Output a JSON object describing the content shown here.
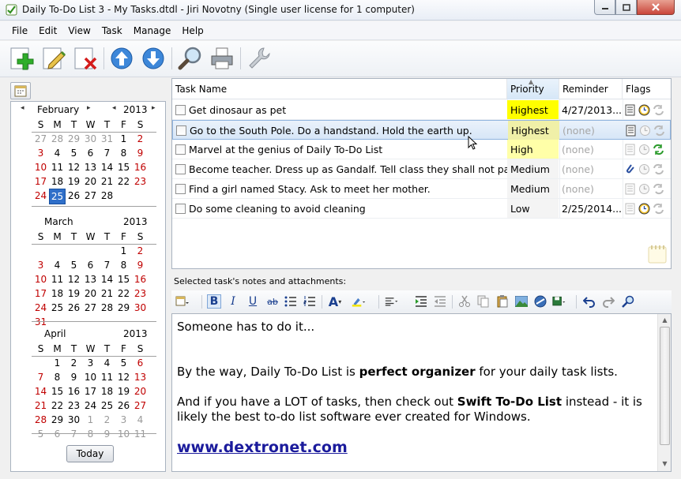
{
  "window": {
    "title": "Daily To-Do List 3 - My Tasks.dtdl - Jiri Novotny (Single user license for 1 computer)"
  },
  "menu": [
    "File",
    "Edit",
    "View",
    "Task",
    "Manage",
    "Help"
  ],
  "toolbar": {
    "icons": [
      "add-task-icon",
      "edit-task-icon",
      "delete-task-icon",
      "move-up-icon",
      "move-down-icon",
      "search-icon",
      "print-icon",
      "settings-wrench-icon"
    ]
  },
  "calendar": {
    "weekday_labels": [
      "S",
      "M",
      "T",
      "W",
      "T",
      "F",
      "S"
    ],
    "today_label": "Today",
    "months": [
      {
        "name": "February",
        "year": "2013",
        "weeks": [
          [
            {
              "d": "27",
              "s": "gray"
            },
            {
              "d": "28",
              "s": "gray"
            },
            {
              "d": "29",
              "s": "gray"
            },
            {
              "d": "30",
              "s": "gray"
            },
            {
              "d": "31",
              "s": "gray"
            },
            {
              "d": "1",
              "s": ""
            },
            {
              "d": "2",
              "s": "red"
            }
          ],
          [
            {
              "d": "3",
              "s": "red"
            },
            {
              "d": "4",
              "s": ""
            },
            {
              "d": "5",
              "s": ""
            },
            {
              "d": "6",
              "s": ""
            },
            {
              "d": "7",
              "s": ""
            },
            {
              "d": "8",
              "s": ""
            },
            {
              "d": "9",
              "s": "red"
            }
          ],
          [
            {
              "d": "10",
              "s": "red"
            },
            {
              "d": "11",
              "s": ""
            },
            {
              "d": "12",
              "s": ""
            },
            {
              "d": "13",
              "s": ""
            },
            {
              "d": "14",
              "s": ""
            },
            {
              "d": "15",
              "s": ""
            },
            {
              "d": "16",
              "s": "red"
            }
          ],
          [
            {
              "d": "17",
              "s": "red"
            },
            {
              "d": "18",
              "s": ""
            },
            {
              "d": "19",
              "s": ""
            },
            {
              "d": "20",
              "s": ""
            },
            {
              "d": "21",
              "s": ""
            },
            {
              "d": "22",
              "s": ""
            },
            {
              "d": "23",
              "s": "red"
            }
          ],
          [
            {
              "d": "24",
              "s": "red"
            },
            {
              "d": "25",
              "s": "today"
            },
            {
              "d": "26",
              "s": ""
            },
            {
              "d": "27",
              "s": ""
            },
            {
              "d": "28",
              "s": ""
            }
          ]
        ]
      },
      {
        "name": "March",
        "year": "2013",
        "weeks": [
          [
            null,
            null,
            null,
            null,
            null,
            {
              "d": "1",
              "s": ""
            },
            {
              "d": "2",
              "s": "red"
            }
          ],
          [
            {
              "d": "3",
              "s": "red"
            },
            {
              "d": "4",
              "s": ""
            },
            {
              "d": "5",
              "s": ""
            },
            {
              "d": "6",
              "s": ""
            },
            {
              "d": "7",
              "s": ""
            },
            {
              "d": "8",
              "s": ""
            },
            {
              "d": "9",
              "s": "red"
            }
          ],
          [
            {
              "d": "10",
              "s": "red"
            },
            {
              "d": "11",
              "s": ""
            },
            {
              "d": "12",
              "s": ""
            },
            {
              "d": "13",
              "s": ""
            },
            {
              "d": "14",
              "s": ""
            },
            {
              "d": "15",
              "s": ""
            },
            {
              "d": "16",
              "s": "red"
            }
          ],
          [
            {
              "d": "17",
              "s": "red"
            },
            {
              "d": "18",
              "s": ""
            },
            {
              "d": "19",
              "s": ""
            },
            {
              "d": "20",
              "s": ""
            },
            {
              "d": "21",
              "s": ""
            },
            {
              "d": "22",
              "s": ""
            },
            {
              "d": "23",
              "s": "red"
            }
          ],
          [
            {
              "d": "24",
              "s": "red"
            },
            {
              "d": "25",
              "s": ""
            },
            {
              "d": "26",
              "s": ""
            },
            {
              "d": "27",
              "s": ""
            },
            {
              "d": "28",
              "s": ""
            },
            {
              "d": "29",
              "s": ""
            },
            {
              "d": "30",
              "s": "red"
            }
          ],
          [
            {
              "d": "31",
              "s": "red"
            }
          ]
        ]
      },
      {
        "name": "April",
        "year": "2013",
        "weeks": [
          [
            null,
            {
              "d": "1",
              "s": ""
            },
            {
              "d": "2",
              "s": ""
            },
            {
              "d": "3",
              "s": ""
            },
            {
              "d": "4",
              "s": ""
            },
            {
              "d": "5",
              "s": ""
            },
            {
              "d": "6",
              "s": "red"
            }
          ],
          [
            {
              "d": "7",
              "s": "red"
            },
            {
              "d": "8",
              "s": ""
            },
            {
              "d": "9",
              "s": ""
            },
            {
              "d": "10",
              "s": ""
            },
            {
              "d": "11",
              "s": ""
            },
            {
              "d": "12",
              "s": ""
            },
            {
              "d": "13",
              "s": "red"
            }
          ],
          [
            {
              "d": "14",
              "s": "red"
            },
            {
              "d": "15",
              "s": ""
            },
            {
              "d": "16",
              "s": ""
            },
            {
              "d": "17",
              "s": ""
            },
            {
              "d": "18",
              "s": ""
            },
            {
              "d": "19",
              "s": ""
            },
            {
              "d": "20",
              "s": "red"
            }
          ],
          [
            {
              "d": "21",
              "s": "red"
            },
            {
              "d": "22",
              "s": ""
            },
            {
              "d": "23",
              "s": ""
            },
            {
              "d": "24",
              "s": ""
            },
            {
              "d": "25",
              "s": ""
            },
            {
              "d": "26",
              "s": ""
            },
            {
              "d": "27",
              "s": "red"
            }
          ],
          [
            {
              "d": "28",
              "s": "red"
            },
            {
              "d": "29",
              "s": ""
            },
            {
              "d": "30",
              "s": ""
            },
            {
              "d": "1",
              "s": "gray"
            },
            {
              "d": "2",
              "s": "gray"
            },
            {
              "d": "3",
              "s": "gray"
            },
            {
              "d": "4",
              "s": "gray"
            }
          ],
          [
            {
              "d": "5",
              "s": "gray"
            },
            {
              "d": "6",
              "s": "gray"
            },
            {
              "d": "7",
              "s": "gray"
            },
            {
              "d": "8",
              "s": "gray"
            },
            {
              "d": "9",
              "s": "gray"
            },
            {
              "d": "10",
              "s": "gray"
            },
            {
              "d": "11",
              "s": "gray"
            }
          ]
        ]
      }
    ]
  },
  "tasks": {
    "columns": {
      "name": "Task Name",
      "priority": "Priority",
      "reminder": "Reminder",
      "flags": "Flags"
    },
    "rows": [
      {
        "name": "Get dinosaur as pet",
        "priority": "Highest",
        "prio_class": "highest",
        "reminder": "4/27/2013...",
        "rem_class": "",
        "selected": false,
        "flags": [
          "notes-icon",
          "clock-icon",
          "repeat-icon"
        ]
      },
      {
        "name": "Go to the South Pole. Do a handstand. Hold the earth up.",
        "priority": "Highest",
        "prio_class": "highest-light",
        "reminder": "(none)",
        "rem_class": "none",
        "selected": true,
        "flags": [
          "notes-icon",
          "clock-icon",
          "repeat-icon"
        ]
      },
      {
        "name": "Marvel at the genius of Daily To-Do List",
        "priority": "High",
        "prio_class": "high",
        "reminder": "(none)",
        "rem_class": "none",
        "selected": false,
        "flags": [
          "notes-icon",
          "clock-icon",
          "repeat-icon"
        ]
      },
      {
        "name": "Become teacher. Dress up as Gandalf. Tell class they shall not pass.",
        "priority": "Medium",
        "prio_class": "medium",
        "reminder": "(none)",
        "rem_class": "none",
        "selected": false,
        "flags": [
          "attachment-icon",
          "clock-icon",
          "repeat-icon"
        ]
      },
      {
        "name": "Find a girl named Stacy. Ask to meet her mother.",
        "priority": "Medium",
        "prio_class": "medium",
        "reminder": "(none)",
        "rem_class": "none",
        "selected": false,
        "flags": [
          "notes-icon",
          "clock-icon",
          "repeat-icon"
        ]
      },
      {
        "name": "Do some cleaning to avoid cleaning",
        "priority": "Low",
        "prio_class": "low",
        "reminder": "2/25/2014...",
        "rem_class": "",
        "selected": false,
        "flags": [
          "notes-icon",
          "clock-icon",
          "repeat-icon"
        ]
      }
    ]
  },
  "notes": {
    "label": "Selected task's notes and attachments:",
    "line1": "Someone has to do it...",
    "line2_pre": "By the way, Daily To-Do List is ",
    "line2_bold": "perfect organizer",
    "line2_post": " for your daily task lists.",
    "line3_pre": "And if you have a LOT of tasks, then check out ",
    "line3_bold": "Swift To-Do List",
    "line3_post": " instead - it is",
    "line4": "likely the best to-do list software ever created for Windows.",
    "link": "www.dextronet.com"
  },
  "colors": {
    "highest": "#ffff00",
    "high": "#ffffa8",
    "selected_row": "#d7e6f7",
    "today": "#2f6fc9",
    "weekend": "#c00000",
    "link": "#1b1b9c"
  }
}
